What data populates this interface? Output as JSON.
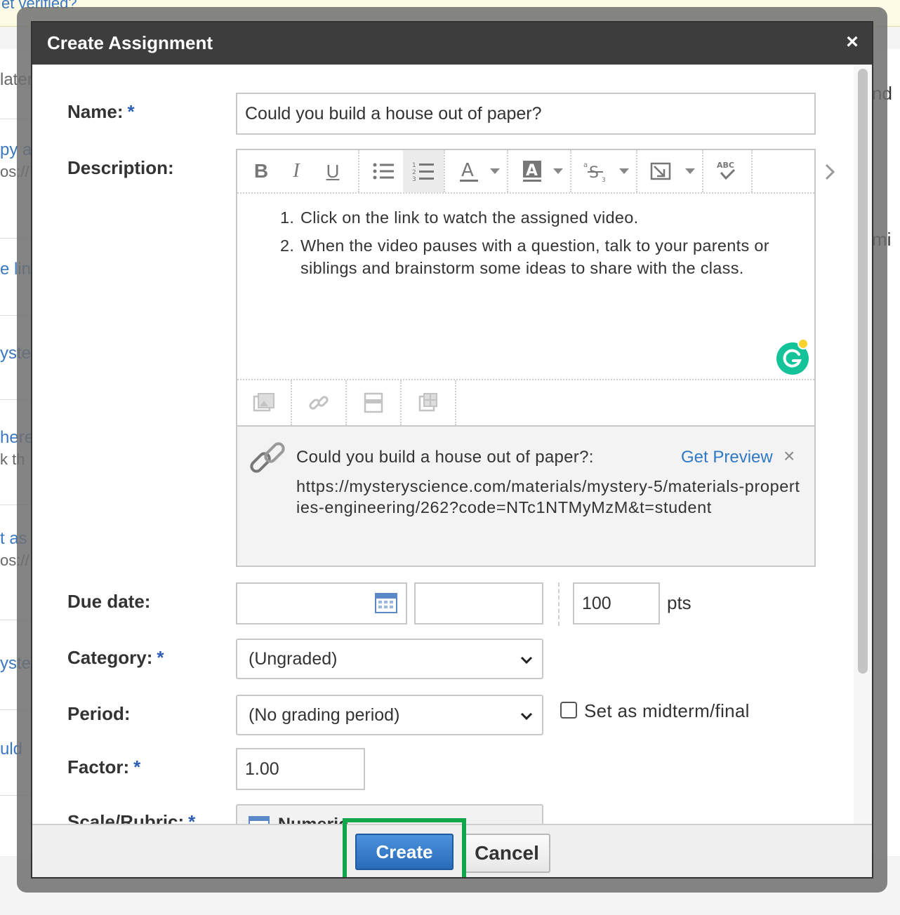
{
  "background": {
    "top_text": "et verified?",
    "left_items": [
      {
        "label": "later",
        "sub": ""
      },
      {
        "label": "py a",
        "sub": "os://"
      },
      {
        "label": "e lin",
        "sub": ""
      },
      {
        "label": "yste",
        "sub": ""
      },
      {
        "label": "here",
        "sub": "k th"
      },
      {
        "label": "t as",
        "sub": "os://"
      },
      {
        "label": "yste",
        "sub": ""
      },
      {
        "label": "uld",
        "sub": ""
      }
    ],
    "right_items": [
      "nd",
      "mi"
    ]
  },
  "dialog": {
    "title": "Create Assignment",
    "close_symbol": "×"
  },
  "form": {
    "name_label": "Name:",
    "required_mark": "*",
    "name_value": "Could you build a house out of paper?",
    "description_label": "Description:",
    "description_items": [
      "Click on the link to watch the assigned video.",
      "When the video pauses with a question, talk to your parents or siblings and brainstorm some ideas to share with the class."
    ],
    "link_title": "Could you build a house out of paper?:",
    "link_url": "https://mysteryscience.com/materials/mystery-5/materials-properties-engineering/262?code=NTc1NTMyMzM&t=student",
    "get_preview": "Get Preview",
    "link_close": "×",
    "due_date_label": "Due date:",
    "due_date_value": "",
    "due_time_value": "",
    "points_value": "100",
    "points_unit": "pts",
    "category_label": "Category:",
    "category_value": "(Ungraded)",
    "period_label": "Period:",
    "period_value": "(No grading period)",
    "midterm_label": "Set as midterm/final",
    "midterm_checked": false,
    "factor_label": "Factor:",
    "factor_value": "1.00",
    "scale_label": "Scale/Rubric:",
    "scale_value": "Numeric"
  },
  "footer": {
    "create_label": "Create",
    "cancel_label": "Cancel"
  },
  "icons": {
    "toolbar": [
      "bold-icon",
      "italic-icon",
      "underline-icon",
      "bullet-list-icon",
      "numbered-list-icon",
      "text-color-icon",
      "highlight-color-icon",
      "superscript-icon",
      "insert-icon",
      "spellcheck-icon"
    ],
    "toolbar2": [
      "image-icon",
      "link-icon",
      "embed-icon",
      "table-icon"
    ]
  },
  "colors": {
    "accent_blue": "#2f78c4",
    "create_button": "#2a6bb8",
    "highlight_green": "#12a64a",
    "titlebar": "#3d3d3d"
  }
}
